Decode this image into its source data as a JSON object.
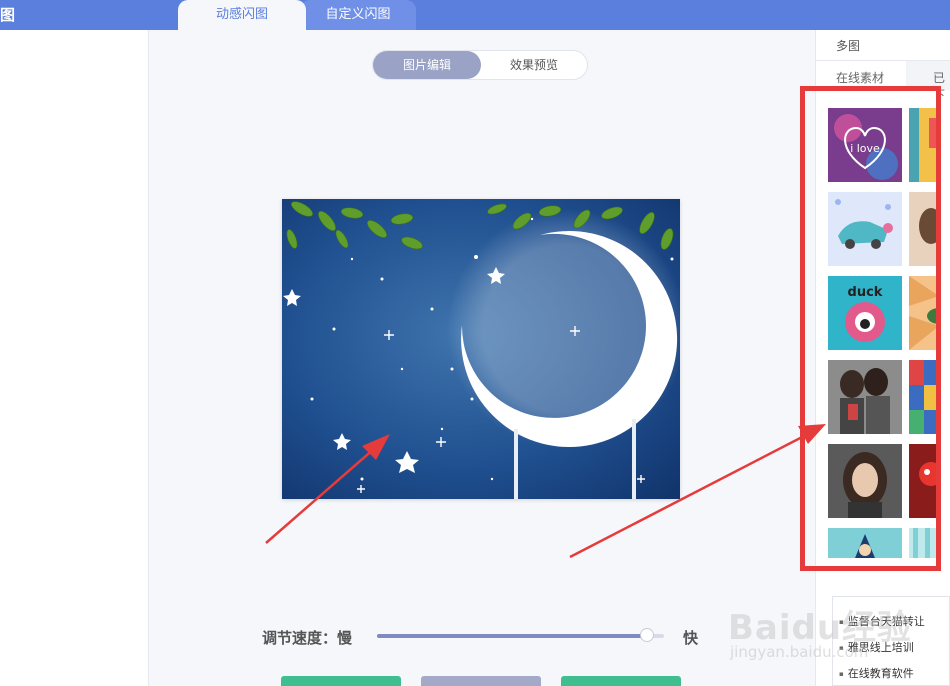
{
  "header": {
    "app_title": "图",
    "tabs": [
      {
        "label": "动感闪图",
        "active": true
      },
      {
        "label": "自定义闪图",
        "active": false
      }
    ]
  },
  "editor": {
    "toggle": {
      "edit_label": "图片编辑",
      "preview_label": "效果预览",
      "selected": "图片编辑"
    },
    "speed": {
      "label": "调节速度：慢",
      "fast_label": "快",
      "value": 0.94
    }
  },
  "right_panel": {
    "title": "多图",
    "tabs": [
      {
        "label": "在线素材"
      },
      {
        "label": "已下"
      }
    ],
    "thumbnails": [
      {
        "name": "i-love-heart"
      },
      {
        "name": "colorful-pattern"
      },
      {
        "name": "cartoon-car"
      },
      {
        "name": "girl-portrait"
      },
      {
        "name": "duck-cartoon"
      },
      {
        "name": "sunburst-umbrella"
      },
      {
        "name": "two-girls-photo"
      },
      {
        "name": "colorful-collage"
      },
      {
        "name": "girl-portrait-2"
      },
      {
        "name": "red-cartoon"
      },
      {
        "name": "cartoon-character"
      },
      {
        "name": "striped-pattern"
      }
    ]
  },
  "ad_list": [
    "监督台天猫转让",
    "雅思线上培训",
    "在线教育软件"
  ],
  "watermark": {
    "text": "Baidu经验",
    "sub": "jingyan.baidu.com"
  },
  "colors": {
    "topbar": "#5a7fdd",
    "highlight_box": "#e53b3b",
    "accent_green": "#3fbf8f"
  }
}
